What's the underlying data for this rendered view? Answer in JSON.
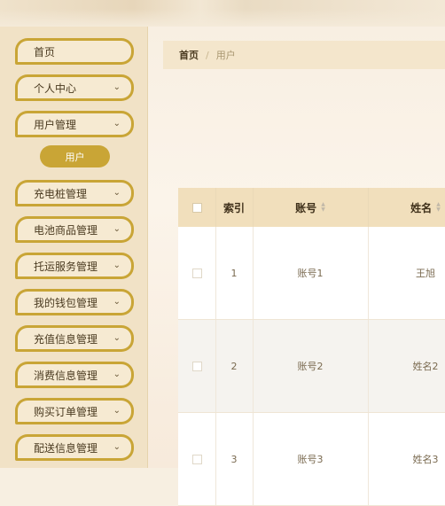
{
  "sidebar": {
    "items": [
      {
        "label": "首页",
        "has_chevron": false
      },
      {
        "label": "个人中心",
        "has_chevron": true
      },
      {
        "label": "用户管理",
        "has_chevron": true
      },
      {
        "label": "充电桩管理",
        "has_chevron": true
      },
      {
        "label": "电池商品管理",
        "has_chevron": true
      },
      {
        "label": "托运服务管理",
        "has_chevron": true
      },
      {
        "label": "我的钱包管理",
        "has_chevron": true
      },
      {
        "label": "充值信息管理",
        "has_chevron": true
      },
      {
        "label": "消费信息管理",
        "has_chevron": true
      },
      {
        "label": "购买订单管理",
        "has_chevron": true
      },
      {
        "label": "配送信息管理",
        "has_chevron": true
      }
    ],
    "submenu": {
      "label": "用户"
    },
    "chevron_glyph": "⌄"
  },
  "breadcrumb": {
    "home": "首页",
    "separator": "/",
    "current": "用户"
  },
  "table": {
    "columns": [
      "索引",
      "账号",
      "姓名"
    ],
    "rows": [
      {
        "index": "1",
        "account": "账号1",
        "name": "王旭"
      },
      {
        "index": "2",
        "account": "账号2",
        "name": "姓名2"
      },
      {
        "index": "3",
        "account": "账号3",
        "name": "姓名3"
      }
    ]
  },
  "colors": {
    "accent": "#c9a536",
    "sidebar_bg": "#f1e2c6",
    "header_bg": "#f1dfbc"
  }
}
